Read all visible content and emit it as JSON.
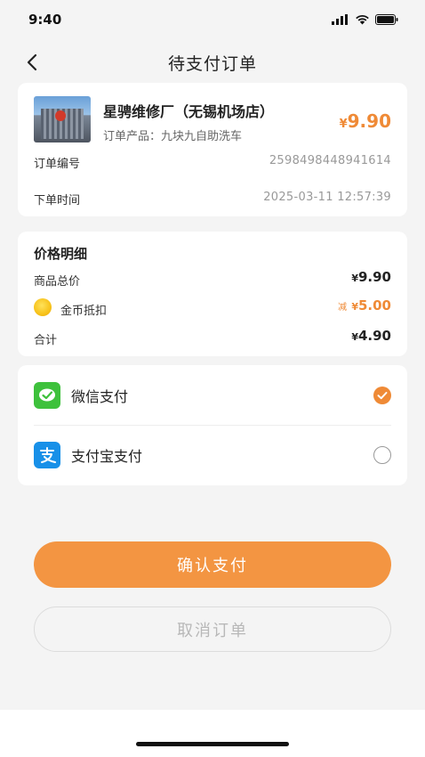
{
  "status_bar": {
    "time": "9:40"
  },
  "nav": {
    "title": "待支付订单"
  },
  "order": {
    "store_name": "星骋维修厂（无锡机场店）",
    "product_label": "订单产品：九块九自助洗车",
    "price_symbol": "¥",
    "price": "9.90",
    "order_no_label": "订单编号",
    "order_no": "2598498448941614",
    "order_time_label": "下单时间",
    "order_time": "2025-03-11 12:57:39"
  },
  "price_detail": {
    "title": "价格明细",
    "total_label": "商品总价",
    "total_symbol": "¥",
    "total_value": "9.90",
    "coin_label": "金币抵扣",
    "coin_prefix": "减",
    "coin_symbol": "¥",
    "coin_value": "5.00",
    "sum_label": "合计",
    "sum_symbol": "¥",
    "sum_value": "4.90"
  },
  "payment": {
    "wechat_label": "微信支付",
    "alipay_label": "支付宝支付",
    "selected": "wechat"
  },
  "buttons": {
    "confirm": "确认支付",
    "cancel": "取消订单"
  },
  "colors": {
    "accent": "#f39542",
    "price_orange": "#ef8a36",
    "wechat_green": "#3ec13c",
    "alipay_blue": "#1890e8"
  }
}
